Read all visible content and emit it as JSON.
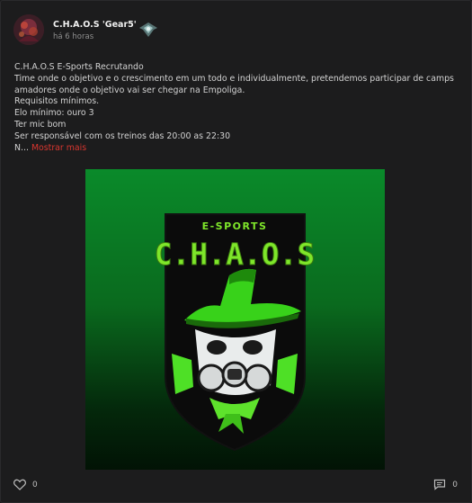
{
  "post": {
    "author": "C.H.A.O.S 'Gear5'",
    "time": "há 6 horas",
    "lines": [
      "C.H.A.O.S E-Sports Recrutando",
      "Time onde o objetivo e o crescimento em um todo e individualmente, pretendemos participar de camps",
      "amadores onde o objetivo vai ser chegar na Empoliga.",
      "Requisitos mínimos.",
      "Elo mínimo: ouro 3",
      "Ter mic bom",
      "Ser responsável com os treinos das 20:00 as 22:30"
    ],
    "truncated_prefix": "N...",
    "show_more": "Mostrar mais",
    "logo": {
      "top_text": "E-SPORTS",
      "main_text": "C.H.A.O.S"
    }
  },
  "footer": {
    "likes": "0",
    "comments": "0",
    "like_icon": "heart-icon",
    "comment_icon": "comment-icon"
  },
  "colors": {
    "accent": "#d9362f",
    "logo_green": "#7ee62a"
  }
}
